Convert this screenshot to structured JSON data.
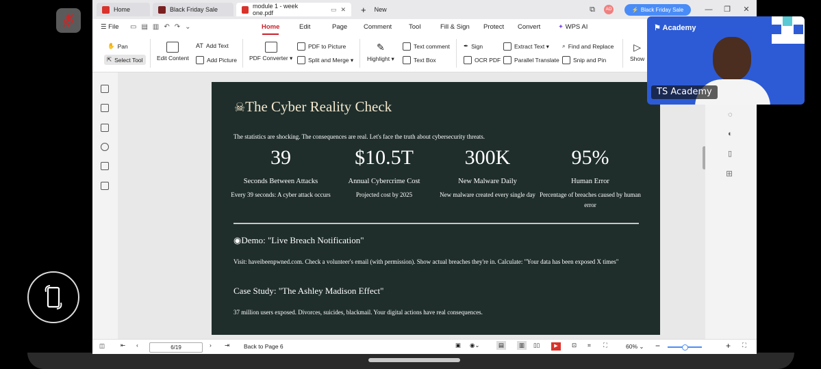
{
  "tabs": [
    {
      "label": "Home"
    },
    {
      "label": "Black Friday Sale"
    },
    {
      "label": "module 1 - week one.pdf"
    },
    {
      "label": "New"
    }
  ],
  "titlebar": {
    "promo_label": "Black Friday Sale",
    "avatar_initials": "AO"
  },
  "menu": {
    "file": "File",
    "items": [
      "Home",
      "Edit",
      "Page",
      "Comment",
      "Tool",
      "Fill & Sign",
      "Protect",
      "Convert",
      "WPS AI"
    ]
  },
  "ribbon": {
    "pan": "Pan",
    "select_tool": "Select Tool",
    "edit_content": "Edit Content",
    "add_text": "Add Text",
    "add_picture": "Add Picture",
    "pdf_converter": "PDF Converter",
    "pdf_to_picture": "PDF to Picture",
    "split_merge": "Split and Merge",
    "highlight": "Highlight",
    "text_comment": "Text comment",
    "text_box": "Text Box",
    "sign": "Sign",
    "ocr_pdf": "OCR PDF",
    "extract_text": "Extract Text",
    "parallel_translate": "Parallel Translate",
    "find_replace": "Find and Replace",
    "snip_pin": "Snip and Pin",
    "show": "Show"
  },
  "document": {
    "title": "The Cyber Reality Check",
    "subtitle": "The statistics are shocking. The consequences are real. Let's face the truth about cybersecurity threats.",
    "stats": [
      {
        "value": "39",
        "label": "Seconds Between Attacks",
        "desc": "Every 39 seconds: A cyber attack occurs"
      },
      {
        "value": "$10.5T",
        "label": "Annual Cybercrime Cost",
        "desc": "Projected cost by 2025"
      },
      {
        "value": "300K",
        "label": "New Malware Daily",
        "desc": "New malware created every single day"
      },
      {
        "value": "95%",
        "label": "Human Error",
        "desc": "Percentage of breaches caused by human error"
      }
    ],
    "demo_heading": "Demo: \"Live Breach Notification\"",
    "demo_body": "Visit: haveibeenpwned.com. Check a volunteer's email (with permission). Show actual breaches they're in. Calculate: \"Your data has been exposed X times\"",
    "case_heading": "Case Study: \"The Ashley Madison Effect\"",
    "case_body": "37 million users exposed. Divorces, suicides, blackmail. Your digital actions have real consequences."
  },
  "status": {
    "page_indicator": "6/19",
    "back_to_page": "Back to Page 6",
    "zoom": "60%"
  },
  "video": {
    "participant_name": "TS Academy",
    "brand": "Academy"
  },
  "colors": {
    "accent": "#c8202a",
    "page_bg": "#1f2e2b",
    "video_bg": "#2d5bd6",
    "promo": "#4a8cf7"
  }
}
